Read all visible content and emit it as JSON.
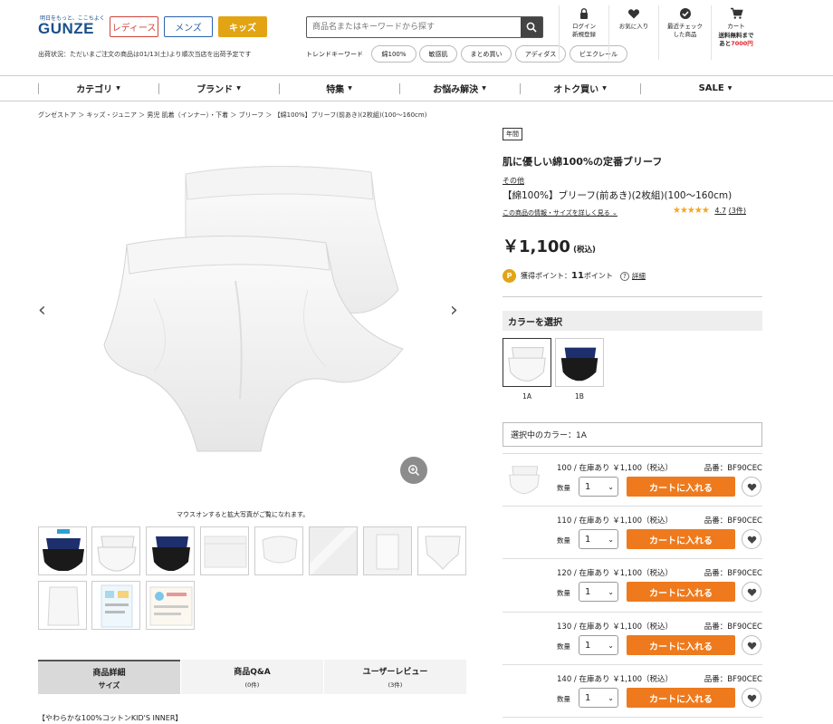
{
  "header": {
    "tagline": "明日をもっと、ここちよく",
    "logo": "GUNZE",
    "genders": [
      "レディース",
      "メンズ",
      "キッズ"
    ],
    "notice": "出荷状況：ただいまご注文の商品は01/13(土)より順次当店を出荷予定です",
    "search_placeholder": "商品名またはキーワードから探す",
    "trend_label": "トレンドキーワード",
    "trends": [
      "綿100%",
      "敏感肌",
      "まとめ買い",
      "アディダス",
      "ビエクレール"
    ],
    "icons": [
      {
        "icon": "user-icon",
        "lines": [
          "ログイン",
          "新規登録"
        ]
      },
      {
        "icon": "heart-icon",
        "lines": [
          "お気に入り"
        ]
      },
      {
        "icon": "check-icon",
        "lines": [
          "最近チェック",
          "した商品"
        ]
      },
      {
        "icon": "cart-icon",
        "lines": [
          "カート"
        ]
      }
    ],
    "cart_free_prefix": "送料無料まで",
    "cart_free_amount_prefix": "あと",
    "cart_free_amount": "7000円"
  },
  "nav": [
    "カテゴリ",
    "ブランド",
    "特集",
    "お悩み解決",
    "オトク買い",
    "SALE"
  ],
  "breadcrumb": "グンゼストア ＞ キッズ・ジュニア ＞ 男児 肌着（インナー）・下着 ＞ ブリーフ ＞ 【綿100%】ブリーフ(前あき)(2枚組)(100〜160cm)",
  "gallery": {
    "hint": "マウスオンすると拡大写真がご覧になれます。"
  },
  "tabs": [
    {
      "label": "商品詳細",
      "sub": "サイズ"
    },
    {
      "label": "商品Q&A",
      "sub": "(0件)"
    },
    {
      "label": "ユーザーレビュー",
      "sub": "(3件)"
    }
  ],
  "description_heading": "【やわらかな100%コットンKID'S INNER】",
  "product": {
    "season_badge": "年間",
    "catch": "肌に優しい綿100%の定番ブリーフ",
    "brand": "その他",
    "name": "【綿100%】ブリーフ(前あき)(2枚組)(100〜160cm)",
    "info_link": "この商品の情報・サイズを詳しく見る",
    "rating": "4.7",
    "review_count": "(3件)",
    "price": "￥1,100",
    "price_tax": "(税込)",
    "points_label": "獲得ポイント：",
    "points_value": "11",
    "points_unit": "ポイント",
    "points_detail": "詳細",
    "color_heading": "カラーを選択",
    "colors": [
      {
        "code": "1A"
      },
      {
        "code": "1B"
      }
    ],
    "selected_color": "選択中のカラー：1A",
    "qty_label": "数量",
    "cart_label": "カートに入れる",
    "variants": [
      {
        "size": "100 / 在庫あり ￥1,100（税込）",
        "code": "品番：BF90CEC",
        "qty": "1"
      },
      {
        "size": "110 / 在庫あり ￥1,100（税込）",
        "code": "品番：BF90CEC",
        "qty": "1"
      },
      {
        "size": "120 / 在庫あり ￥1,100（税込）",
        "code": "品番：BF90CEC",
        "qty": "1"
      },
      {
        "size": "130 / 在庫あり ￥1,100（税込）",
        "code": "品番：BF90CEC",
        "qty": "1"
      },
      {
        "size": "140 / 在庫あり ￥1,100（税込）",
        "code": "品番：BF90CEC",
        "qty": "1"
      }
    ]
  }
}
